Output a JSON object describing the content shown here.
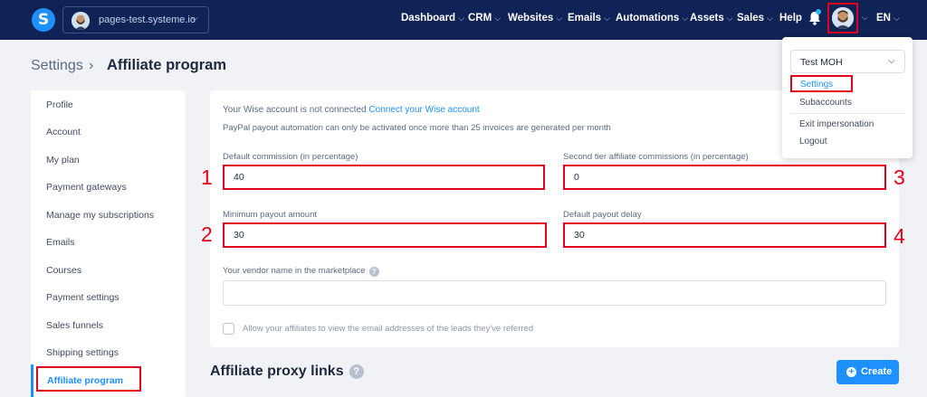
{
  "nav": {
    "logo_letter": "S",
    "site": "pages-test.systeme.io",
    "items": [
      {
        "label": "Dashboard",
        "chevron": "⌵"
      },
      {
        "label": "CRM",
        "chevron": "⌵"
      },
      {
        "label": "Websites",
        "chevron": "⌵"
      },
      {
        "label": "Emails",
        "chevron": "⌵"
      },
      {
        "label": "Automations",
        "chevron": "⌵"
      },
      {
        "label": "Assets",
        "chevron": "⌵"
      },
      {
        "label": "Sales",
        "chevron": "⌵"
      },
      {
        "label": "Help",
        "chevron": ""
      }
    ],
    "language": "EN"
  },
  "breadcrumb": {
    "parent": "Settings",
    "separator": "›",
    "current": "Affiliate program"
  },
  "sidebar": {
    "items": [
      "Profile",
      "Account",
      "My plan",
      "Payment gateways",
      "Manage my subscriptions",
      "Emails",
      "Courses",
      "Payment settings",
      "Sales funnels",
      "Shipping settings"
    ],
    "active": "Affiliate program"
  },
  "form": {
    "wise_notice": "Your Wise account is not connected",
    "wise_link": "Connect your Wise account",
    "paypal_notice": "PayPal payout automation can only be activated once more than 25 invoices are generated per month",
    "default_commission_label": "Default commission (in percentage)",
    "default_commission_value": "40",
    "second_tier_label": "Second tier affiliate commissions (in percentage)",
    "second_tier_value": "0",
    "min_payout_label": "Minimum payout amount",
    "min_payout_value": "30",
    "payout_delay_label": "Default payout delay",
    "payout_delay_value": "30",
    "vendor_name_label": "Your vendor name in the marketplace",
    "vendor_name_value": "",
    "allow_emails_label": "Allow your affiliates to view the email addresses of the leads they've referred"
  },
  "annotations": [
    "1",
    "2",
    "3",
    "4"
  ],
  "proxy": {
    "title": "Affiliate proxy links",
    "help": "?",
    "create_label": "Create",
    "create_icon": "+"
  },
  "user_menu": {
    "account": "Test MOH",
    "items": [
      "Settings",
      "Subaccounts",
      "Exit impersonation",
      "Logout"
    ]
  },
  "colors": {
    "navbar": "#0f2356",
    "accent": "#1e90ff",
    "highlight": "#e3001b"
  }
}
